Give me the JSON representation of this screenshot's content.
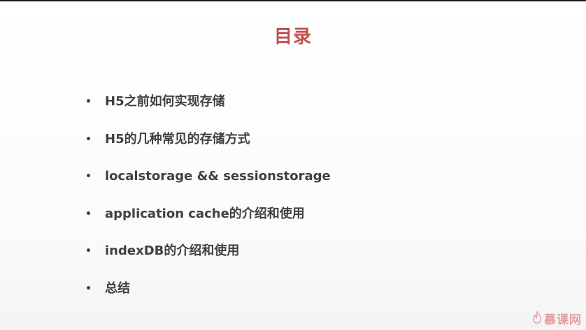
{
  "slide": {
    "title": "目录",
    "items": [
      "H5之前如何实现存储",
      "H5的几种常见的存储方式",
      "localstorage && sessionstorage",
      "application cache的介绍和使用",
      "indexDB的介绍和使用",
      "总结"
    ],
    "bullet": "•"
  },
  "watermark": {
    "text": "慕课网",
    "icon": "flame-icon"
  },
  "colors": {
    "title": "#c0504d",
    "body_text": "#404040",
    "watermark": "#d35b5b"
  }
}
